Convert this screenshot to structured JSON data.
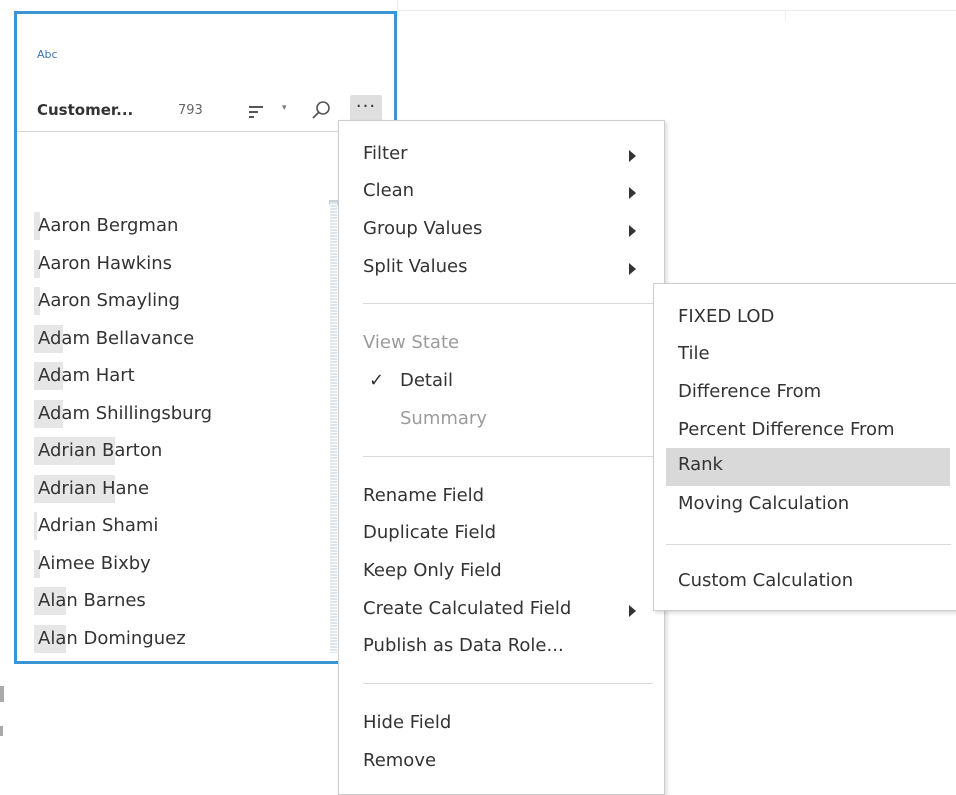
{
  "card": {
    "type_label": "Abc",
    "field_name": "Customer...",
    "count": "793",
    "values": [
      {
        "name": "Aaron Bergman",
        "bar_fraction": 0.02
      },
      {
        "name": "Aaron Hawkins",
        "bar_fraction": 0.02
      },
      {
        "name": "Aaron Smayling",
        "bar_fraction": 0.02
      },
      {
        "name": "Adam Bellavance",
        "bar_fraction": 0.1
      },
      {
        "name": "Adam Hart",
        "bar_fraction": 0.1
      },
      {
        "name": "Adam Shillingsburg",
        "bar_fraction": 0.1
      },
      {
        "name": "Adrian Barton",
        "bar_fraction": 0.28
      },
      {
        "name": "Adrian Hane",
        "bar_fraction": 0.28
      },
      {
        "name": "Adrian Shami",
        "bar_fraction": 0.01
      },
      {
        "name": "Aimee Bixby",
        "bar_fraction": 0.02
      },
      {
        "name": "Alan Barnes",
        "bar_fraction": 0.11
      },
      {
        "name": "Alan Dominguez",
        "bar_fraction": 0.11
      }
    ]
  },
  "menu": {
    "filter": "Filter",
    "clean": "Clean",
    "group_values": "Group Values",
    "split_values": "Split Values",
    "view_state": "View State",
    "detail": "Detail",
    "check": "✓",
    "summary": "Summary",
    "rename_field": "Rename Field",
    "duplicate_field": "Duplicate Field",
    "keep_only_field": "Keep Only Field",
    "create_calculated_field": "Create Calculated Field",
    "publish_as_data_role": "Publish as Data Role...",
    "hide_field": "Hide Field",
    "remove": "Remove"
  },
  "submenu": {
    "fixed_lod": "FIXED LOD",
    "tile": "Tile",
    "difference_from": "Difference From",
    "percent_difference_from": "Percent Difference From",
    "rank": "Rank",
    "moving_calculation": "Moving Calculation",
    "custom_calculation": "Custom Calculation",
    "highlighted": "Rank"
  },
  "icons": {
    "sort": "sort-icon",
    "sort_dropdown": "▾",
    "search": "search-icon",
    "more": "···"
  },
  "colors": {
    "card_border": "#3b95d4",
    "highlight": "#d9d9d9",
    "bar": "#e6e6e6"
  }
}
